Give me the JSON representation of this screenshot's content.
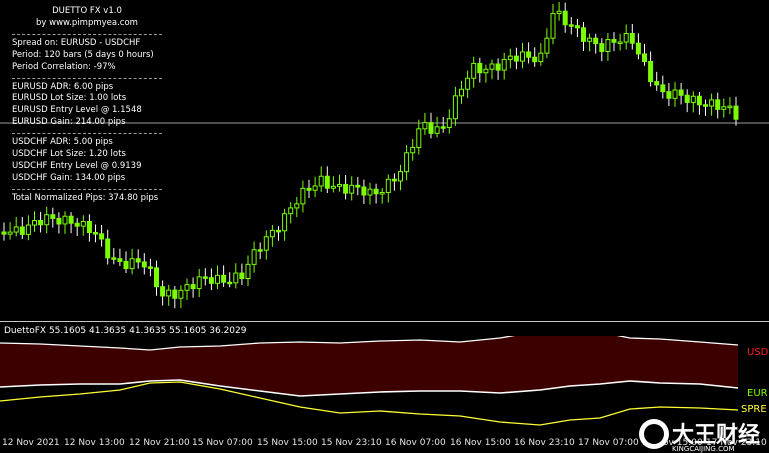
{
  "info_panel": {
    "title": "DUETTO FX v1.0",
    "website": "by www.pimpmyea.com",
    "spread": "Spread on: EURUSD - USDCHF",
    "period": "Period: 120 bars (5 days 0 hours)",
    "correlation": "Period Correlation: -97%",
    "eurusd_adr": "EURUSD ADR: 6.00    pips",
    "eurusd_lot": "EURUSD Lot Size: 1.00 lots",
    "eurusd_entry": "EURUSD Entry Level @ 1.1548",
    "eurusd_gain": "EURUSD Gain: 214.00 pips",
    "usdchf_adr": "USDCHF ADR: 5.00    pips",
    "usdchf_lot": "USDCHF Lot Size: 1.20 lots",
    "usdchf_entry": "USDCHF Entry Level @ 0.9139",
    "usdchf_gain": "USDCHF Gain: 134.00 pips",
    "total": "Total Normalized Pips: 374.80 pips"
  },
  "indicator": {
    "title": "DuettoFX 55.1605 41.3635 41.3635 55.1605 36.2029",
    "label_usd": "USD",
    "label_eur": "EUR",
    "label_spread": "SPRE"
  },
  "time_axis": [
    "12 Nov 2021",
    "12 Nov 13:00",
    "12 Nov 21:00",
    "15 Nov 07:00",
    "15 Nov 15:00",
    "15 Nov 23:10",
    "16 Nov 07:00",
    "16 Nov 15:00",
    "16 Nov 23:10",
    "17 Nov 07:00",
    "17 Nov 15:00",
    "17 Nov 23:10"
  ],
  "watermark": {
    "text": "大王财经",
    "url": "KINGCAIJING.COM"
  },
  "colors": {
    "background": "#000000",
    "bull_candle": "#7cfc00",
    "bear_candle": "#ffffff",
    "entry_line": "#a0a0a0",
    "usd_fill": "#3d0000",
    "usd_label": "#ff2020",
    "eur_line": "#ffffff",
    "eur_label": "#7cfc00",
    "spread_line": "#ffff33",
    "spread_label": "#ffff33"
  }
}
